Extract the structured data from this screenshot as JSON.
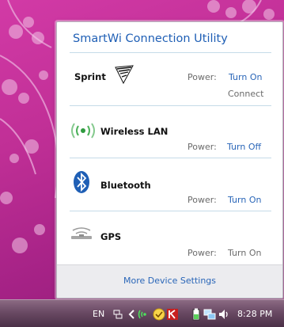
{
  "utility": {
    "title": "SmartWi Connection Utility"
  },
  "devices": {
    "sprint": {
      "name": "Sprint",
      "power_label": "Power:",
      "power_action": "Turn On",
      "secondary_action": "Connect"
    },
    "wlan": {
      "name": "Wireless LAN",
      "power_label": "Power:",
      "power_action": "Turn Off"
    },
    "bluetooth": {
      "name": "Bluetooth",
      "power_label": "Power:",
      "power_action": "Turn On"
    },
    "gps": {
      "name": "GPS",
      "power_label": "Power:",
      "power_action": "Turn On"
    }
  },
  "footer": {
    "more_settings": "More Device Settings"
  },
  "taskbar": {
    "language": "EN",
    "clock": "8:28 PM",
    "tray_icons": [
      "show-hidden-chevron-icon",
      "wireless-signal-icon",
      "smartwi-icon",
      "antivirus-icon",
      "battery-icon",
      "network-icon",
      "volume-icon"
    ]
  },
  "colors": {
    "link": "#2a66b8",
    "title": "#1f5fb5",
    "separator": "#c5dbe8",
    "desktop": "#c02f96"
  }
}
